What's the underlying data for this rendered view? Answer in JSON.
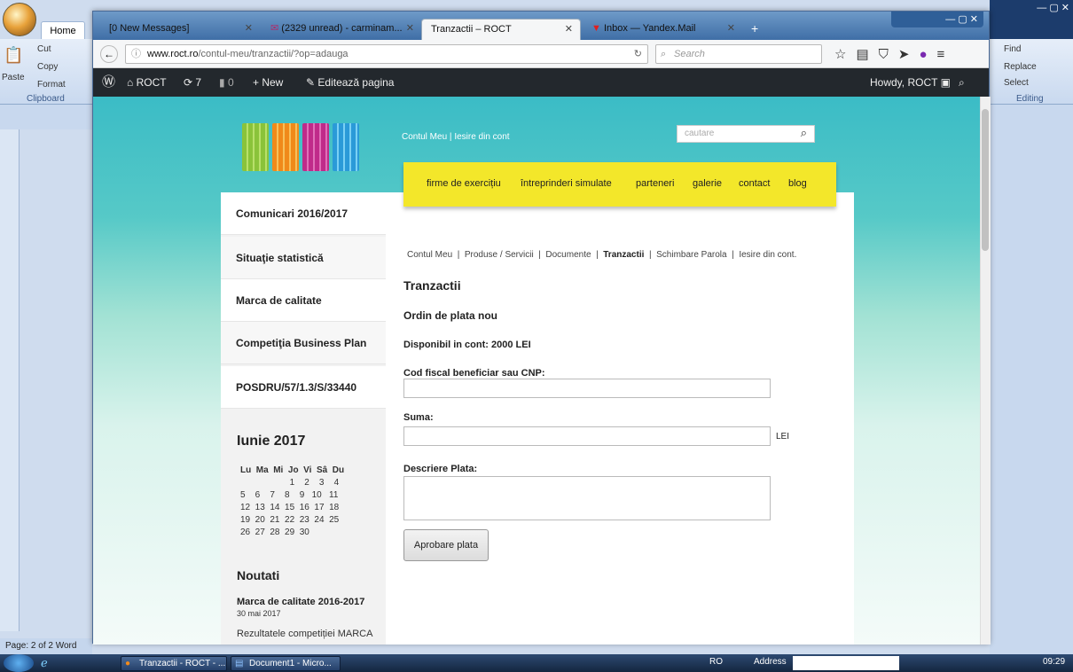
{
  "word": {
    "home_tab": "Home",
    "clipboard_cut": "Cut",
    "clipboard_copy": "Copy",
    "clipboard_paste": "Paste",
    "clipboard_format": "Format",
    "clipboard_group": "Clipboard",
    "find": "Find",
    "replace": "Replace",
    "select": "Select",
    "editing_group": "Editing",
    "status_page": "Page: 2 of 2",
    "status_word": "Word"
  },
  "browser": {
    "tabs": [
      {
        "label": "[0 New Messages]"
      },
      {
        "label": "(2329 unread) - carminam..."
      },
      {
        "label": "Tranzactii – ROCT"
      },
      {
        "label": "Inbox — Yandex.Mail"
      }
    ],
    "url": "www.roct.ro/contul-meu/tranzactii/?op=adauga",
    "url_domain": "www.roct.ro",
    "url_path": "/contul-meu/tranzactii/?op=adauga",
    "search_placeholder": "Search"
  },
  "wpbar": {
    "site": "ROCT",
    "updates": "7",
    "comments": "0",
    "new": "New",
    "edit": "Editează pagina",
    "howdy": "Howdy, ROCT"
  },
  "site": {
    "top_link_account": "Contul Meu",
    "top_link_sep": "|",
    "top_link_logout": "Iesire din cont",
    "search_placeholder": "cautare",
    "nav": [
      "firme de exercițiu",
      "întreprinderi simulate",
      "parteneri",
      "galerie",
      "contact",
      "blog"
    ],
    "sidebar": [
      "Comunicari 2016/2017",
      "Situaţie statistică",
      "Marca de calitate",
      "Competiţia Business Plan",
      "POSDRU/57/1.3/S/33440"
    ],
    "calendar_title": "Iunie 2017",
    "calendar_header": "Lu  Ma  Mi  Jo  Vi  Sâ  Du",
    "calendar_rows": [
      "                    1    2    3    4",
      "5    6    7    8    9   10   11",
      "12  13  14  15  16  17  18",
      "19  20  21  22  23  24  25",
      "26  27  28  29  30"
    ],
    "news_title": "Noutati",
    "news_item_title": "Marca de calitate 2016-2017",
    "news_item_date": "30 mai 2017",
    "news_item_text": "Rezultatele competiției MARCA",
    "subnav": [
      "Contul Meu",
      "Produse / Servicii",
      "Documente",
      "Tranzactii",
      "Schimbare Parola",
      "Iesire din cont."
    ],
    "page_title": "Tranzactii",
    "form_title": "Ordin de plata nou",
    "available": "Disponibil in cont: 2000 LEI",
    "label_cod": "Cod fiscal beneficiar sau CNP:",
    "label_suma": "Suma:",
    "suma_unit": "LEI",
    "label_descriere": "Descriere Plata:",
    "submit": "Aprobare plata"
  },
  "taskbar": {
    "firefox": "Tranzactii - ROCT - ...",
    "word": "Document1 - Micro...",
    "lang": "RO",
    "address": "Address",
    "time": "09:29"
  }
}
